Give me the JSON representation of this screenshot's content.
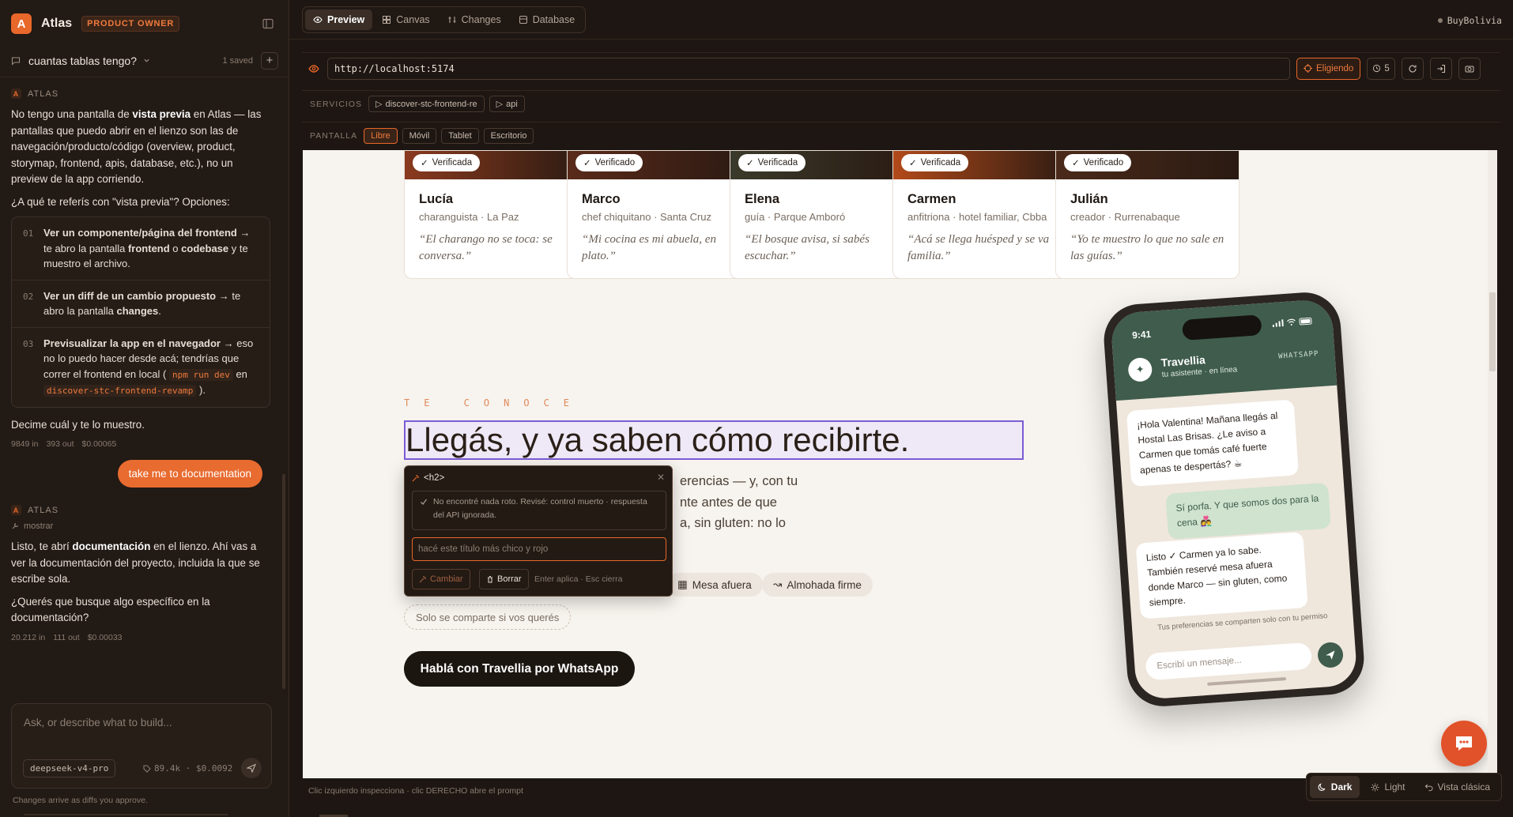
{
  "sidebar": {
    "logo_letter": "A",
    "app_name": "Atlas",
    "role_badge": "PRODUCT OWNER",
    "conversation_title": "cuantas tablas tengo?",
    "saved_count": "1 saved",
    "messages": {
      "assistant1": {
        "sender": "ATLAS",
        "p1_a": "No tengo una pantalla de ",
        "p1_b": "vista previa",
        "p1_c": " en Atlas — las pantallas que puedo abrir en el lienzo son las de navegación/producto/código (overview, product, storymap, frontend, apis, database, etc.), no un preview de la app corriendo.",
        "p2": "¿A qué te referís con \"vista previa\"? Opciones:",
        "options": [
          {
            "num": "01",
            "b": "Ver un componente/página del frontend",
            "t1": " → te abro la pantalla ",
            "b2": "frontend",
            "t2": " o ",
            "b3": "codebase",
            "t3": " y te muestro el archivo."
          },
          {
            "num": "02",
            "b": "Ver un diff de un cambio propuesto",
            "t1": " → te abro la pantalla ",
            "b2": "changes",
            "t2": ".",
            "b3": "",
            "t3": ""
          },
          {
            "num": "03",
            "b": "Previsualizar la app en el navegador",
            "t1": " → eso no lo puedo hacer desde acá; tendrías que correr el frontend en local ( ",
            "code1": "npm run dev",
            "t2": " en ",
            "code2": "discover-stc-frontend-revamp",
            "t3": " )."
          }
        ],
        "p3": "Decime cuál y te lo muestro.",
        "stats": [
          "9849 in",
          "393 out",
          "$0.00065"
        ]
      },
      "user1": "take me to documentation",
      "assistant2": {
        "sender": "ATLAS",
        "tool": "mostrar",
        "p1_a": "Listo, te abrí ",
        "p1_b": "documentación",
        "p1_c": " en el lienzo. Ahí vas a ver la documentación del proyecto, incluida la que se escribe sola.",
        "p2": "¿Querés que busque algo específico en la documentación?",
        "stats": [
          "20.212 in",
          "111 out",
          "$0.00033"
        ]
      }
    },
    "composer": {
      "placeholder": "Ask, or describe what to build...",
      "model": "deepseek-v4-pro",
      "tokens": "89.4k · $0.0092"
    },
    "footer": "Changes arrive as diffs you approve."
  },
  "topbar": {
    "tabs": [
      {
        "label": "Preview",
        "icon": "eye-icon",
        "active": true
      },
      {
        "label": "Canvas",
        "icon": "grid-icon",
        "active": false
      },
      {
        "label": "Changes",
        "icon": "diff-icon",
        "active": false
      },
      {
        "label": "Database",
        "icon": "database-icon",
        "active": false
      }
    ],
    "project": "BuyBolivia"
  },
  "browser": {
    "url": "http://localhost:5174",
    "pick_label": "Eligiendo",
    "history_count": "5",
    "services_label": "SERVICIOS",
    "services": [
      "discover-stc-frontend-re",
      "api"
    ],
    "screen_label": "PANTALLA",
    "screens": [
      {
        "label": "Libre",
        "selected": true
      },
      {
        "label": "Móvil",
        "selected": false
      },
      {
        "label": "Tablet",
        "selected": false
      },
      {
        "label": "Escritorio",
        "selected": false
      }
    ]
  },
  "preview": {
    "cards": [
      {
        "badge": "Verificada",
        "name": "Lucía",
        "role": "charanguista · La Paz",
        "quote": "“El charango no se toca: se conversa.”",
        "img_color": "#8a3a1e"
      },
      {
        "badge": "Verificado",
        "name": "Marco",
        "role": "chef chiquitano · Santa Cruz",
        "quote": "“Mi cocina es mi abuela, en plato.”",
        "img_color": "#5a2a1a"
      },
      {
        "badge": "Verificada",
        "name": "Elena",
        "role": "guía · Parque Amboró",
        "quote": "“El bosque avisa, si sabés escuchar.”",
        "img_color": "#3a3a2a"
      },
      {
        "badge": "Verificada",
        "name": "Carmen",
        "role": "anfitriona · hotel familiar, Cbba",
        "quote": "“Acá se llega huésped y se va familia.”",
        "img_color": "#b24a1a"
      },
      {
        "badge": "Verificado",
        "name": "Julián",
        "role": "creador · Rurrenabaque",
        "quote": "“Yo te muestro lo que no sale en las guías.”",
        "img_color": "#4a2a1a"
      }
    ],
    "eyebrow": "TE CONOCE",
    "headline": "Llegás, y ya saben cómo recibirte.",
    "body_lines": [
      "erencias — y, con tu",
      "nte antes de que",
      "a, sin gluten: no lo"
    ],
    "prefs": [
      "Mesa afuera",
      "Almohada firme"
    ],
    "share_note": "Solo se comparte si vos querés",
    "cta": "Hablá con Travellia por WhatsApp",
    "inspector": {
      "tag": "<h2>",
      "ok": "No encontré nada roto. Revisé: control muerto · respuesta del API ignorada.",
      "prompt_value": "hacé este título más chico y rojo",
      "apply": "Cambiar",
      "delete": "Borrar",
      "hint": "Enter aplica · Esc cierra"
    },
    "phone": {
      "time": "9:41",
      "contact": "Travellia",
      "status": "tu asistente · en línea",
      "channel": "WHATSAPP",
      "m1": "¡Hola Valentina! Mañana llegás al Hostal Las Brisas. ¿Le aviso a Carmen que tomás café fuerte apenas te despertás? ☕",
      "m2": "Sí porfa. Y que somos dos para la cena 👩‍❤️‍👨",
      "m3": "Listo ✓ Carmen ya lo sabe. También reservé mesa afuera donde Marco — sin gluten, como siempre.",
      "privacy": "Tus preferencias se comparten solo con tu permiso",
      "input_placeholder": "Escribí un mensaje..."
    }
  },
  "statusbar": {
    "hint": "Clic izquierdo inspecciona · clic DERECHO abre el prompt",
    "dark": "Dark",
    "light": "Light",
    "classic": "Vista clásica"
  }
}
